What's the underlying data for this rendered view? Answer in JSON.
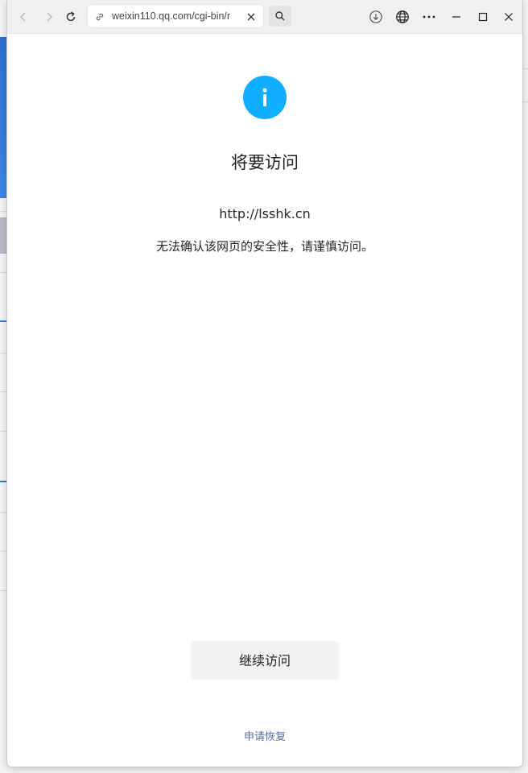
{
  "browser": {
    "address_text": "weixin110.qq.com/cgi-bin/r",
    "icons": {
      "back": "back-arrow-icon",
      "forward": "forward-arrow-icon",
      "refresh": "refresh-icon",
      "link": "link-icon",
      "clear": "close-icon",
      "search": "search-icon",
      "download": "download-icon",
      "translate": "globe-icon",
      "more": "more-icon",
      "minimize": "minimize-icon",
      "maximize": "maximize-icon",
      "close": "window-close-icon"
    }
  },
  "page": {
    "icon": "info-icon",
    "title": "将要访问",
    "url": "http://lsshk.cn",
    "description": "无法确认该网页的安全性，请谨慎访问。",
    "continue_label": "继续访问",
    "restore_label": "申请恢复"
  },
  "colors": {
    "accent": "#10aeff",
    "link": "#576b95",
    "button_bg": "#f2f2f2"
  }
}
